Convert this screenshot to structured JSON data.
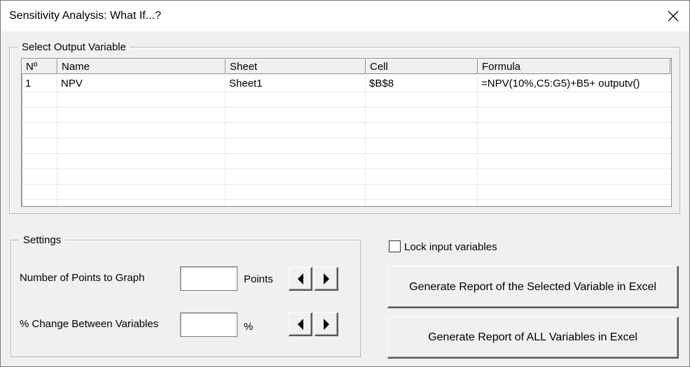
{
  "window": {
    "title": "Sensitivity Analysis: What If...?"
  },
  "output_group": {
    "legend": "Select Output Variable",
    "columns": [
      "Nº",
      "Name",
      "Sheet",
      "Cell",
      "Formula"
    ],
    "rows": [
      {
        "no": "1",
        "name": "NPV",
        "sheet": "Sheet1",
        "cell": "$B$8",
        "formula": "=NPV(10%,C5:G5)+B5+ outputv()"
      }
    ]
  },
  "settings": {
    "legend": "Settings",
    "points_label": "Number of Points to Graph",
    "points_value": "",
    "points_unit": "Points",
    "change_label": "% Change Between Variables",
    "change_value": "",
    "change_unit": "%"
  },
  "lock_input": {
    "label": "Lock input variables",
    "checked": false
  },
  "buttons": {
    "report_selected": "Generate Report of the Selected Variable in Excel",
    "report_all": "Generate Report of ALL Variables in Excel"
  },
  "icons": [
    "close-icon",
    "left-arrow-icon",
    "right-arrow-icon"
  ]
}
